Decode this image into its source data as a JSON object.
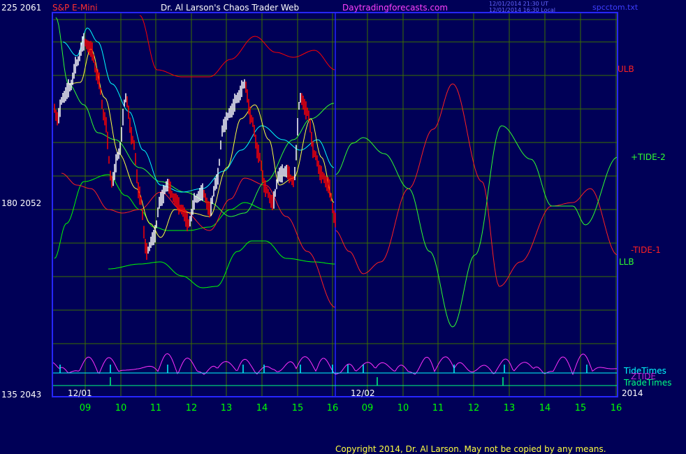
{
  "header": {
    "symbol": "S&P E-Mini",
    "title": "Dr. Al Larson's Chaos Trader Web",
    "site": "Daytradingforecasts.com",
    "time_utc": "12/01/2014 21:30 UT",
    "time_local": "12/01/2014 16:30 Local",
    "file": "spcctom.txt"
  },
  "axis_left": {
    "top": "225  2061",
    "mid": "180  2052",
    "bottom": "135  2043"
  },
  "right_labels": {
    "ulb": "ULB",
    "tide2": "+TIDE-2",
    "tide1": "-TIDE-1",
    "llb": "LLB",
    "tide_times": "TideTimes",
    "ztide": "ZTIDE",
    "trade_times": "TradeTimes"
  },
  "date_labels": {
    "d1": "12/01",
    "d2": "12/02",
    "year": "2014"
  },
  "footer": {
    "copyright": "Copyright 2014, Dr. Al Larson. May not be copied by any means."
  },
  "colors": {
    "background": "#000057",
    "frame": "#2626ff",
    "grid": "#3c6f00",
    "price_up": "#ffffff",
    "price_down": "#ff0000",
    "ulb": "#ff0000",
    "llb": "#00ff00",
    "tide_red": "#ff2020",
    "tide_green": "#30ff30",
    "ma_cyan": "#00ffff",
    "ma_yellow": "#ffff40",
    "ztide": "#ff30ff",
    "tide_times": "#00ffff",
    "trade_times": "#00ff80"
  },
  "chart_data": {
    "type": "line",
    "title": "S&P E-Mini",
    "y_axis": {
      "labels": [
        "225  2061",
        "180  2052",
        "135  2043"
      ],
      "range_price": [
        2043,
        2061
      ],
      "range_oscillator": [
        135,
        225
      ]
    },
    "x_axis": {
      "tick_labels": [
        "09",
        "10",
        "11",
        "12",
        "13",
        "14",
        "15",
        "16",
        "09",
        "10",
        "11",
        "12",
        "13",
        "14",
        "15",
        "16"
      ],
      "date_markers": [
        "12/01",
        "12/02",
        "2014"
      ]
    },
    "price_bars_approx": {
      "description_free_points_time_hour": [
        8.8,
        9.0,
        9.1,
        9.3,
        9.5,
        9.8,
        10.0,
        10.3,
        10.6,
        10.9,
        11.2,
        11.5,
        11.8,
        12.1,
        12.4,
        12.7,
        13.0,
        13.3,
        13.6,
        13.9,
        14.1,
        14.4,
        14.7,
        15.0,
        15.2,
        15.5,
        15.8,
        16.0
      ],
      "close": [
        2057.5,
        2056.8,
        2058.3,
        2059.6,
        2058.0,
        2055.8,
        2053.2,
        2052.0,
        2051.0,
        2050.0,
        2053.5,
        2052.6,
        2051.0,
        2050.8,
        2052.5,
        2051.2,
        2055.0,
        2057.0,
        2058.0,
        2057.4,
        2054.2,
        2052.4,
        2053.8,
        2055.2,
        2057.5,
        2054.5,
        2053.0,
        2050.5
      ]
    },
    "series": [
      {
        "name": "ULB",
        "color": "#ff0000"
      },
      {
        "name": "+TIDE-2",
        "color": "#30ff30"
      },
      {
        "name": "-TIDE-1",
        "color": "#ff2020"
      },
      {
        "name": "LLB",
        "color": "#00ff00"
      },
      {
        "name": "ZTIDE",
        "color": "#ff30ff"
      },
      {
        "name": "TideTimes",
        "color": "#00ffff"
      },
      {
        "name": "TradeTimes",
        "color": "#00ff80"
      }
    ],
    "grid": true
  }
}
